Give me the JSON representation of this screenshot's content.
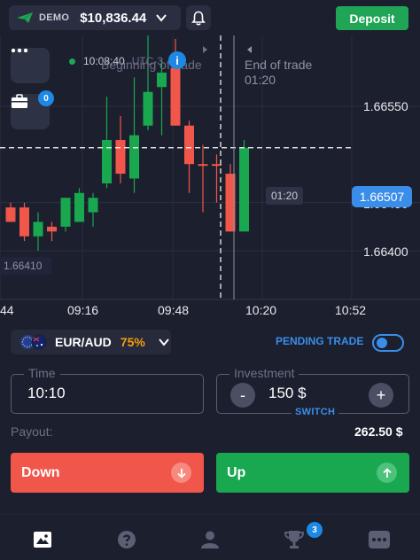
{
  "header": {
    "account_type": "DEMO",
    "balance": "$10,836.44",
    "deposit_label": "Deposit"
  },
  "chart": {
    "menu_badge": "0",
    "server_time": "10:08:40",
    "timezone": "UTC-3",
    "beginning_label": "Beginning of trade",
    "end_label": "End of trade",
    "end_time": "01:20",
    "current_price": "1.66507",
    "timer": "01:20",
    "low_price": "1.66410"
  },
  "chart_data": {
    "type": "candlestick",
    "y_ticks": [
      "1.66550",
      "1.66450",
      "1.66400"
    ],
    "x_ticks": [
      "44",
      "09:16",
      "09:48",
      "10:20",
      "10:52"
    ],
    "ylim": [
      1.6635,
      1.6672
    ],
    "current_price": 1.66507,
    "candles": [
      {
        "open": 1.66445,
        "close": 1.6643,
        "high": 1.6645,
        "low": 1.6643
      },
      {
        "open": 1.66445,
        "close": 1.66415,
        "high": 1.6645,
        "low": 1.6641
      },
      {
        "open": 1.66415,
        "close": 1.6643,
        "high": 1.6644,
        "low": 1.664
      },
      {
        "open": 1.66425,
        "close": 1.6642,
        "high": 1.6643,
        "low": 1.6641
      },
      {
        "open": 1.66425,
        "close": 1.66455,
        "high": 1.66455,
        "low": 1.6642
      },
      {
        "open": 1.6643,
        "close": 1.6646,
        "high": 1.66465,
        "low": 1.6643
      },
      {
        "open": 1.6644,
        "close": 1.66455,
        "high": 1.6646,
        "low": 1.66425
      },
      {
        "open": 1.6647,
        "close": 1.66515,
        "high": 1.6656,
        "low": 1.66465
      },
      {
        "open": 1.66515,
        "close": 1.6648,
        "high": 1.6654,
        "low": 1.6647
      },
      {
        "open": 1.66475,
        "close": 1.6652,
        "high": 1.6658,
        "low": 1.6646
      },
      {
        "open": 1.6653,
        "close": 1.66565,
        "high": 1.6663,
        "low": 1.66525
      },
      {
        "open": 1.6657,
        "close": 1.66585,
        "high": 1.666,
        "low": 1.6652
      },
      {
        "open": 1.6659,
        "close": 1.6653,
        "high": 1.6662,
        "low": 1.6653
      },
      {
        "open": 1.6653,
        "close": 1.6649,
        "high": 1.66535,
        "low": 1.6646
      },
      {
        "open": 1.6649,
        "close": 1.6649,
        "high": 1.6651,
        "low": 1.6644
      },
      {
        "open": 1.6649,
        "close": 1.6649,
        "high": 1.665,
        "low": 1.6645
      },
      {
        "open": 1.6648,
        "close": 1.6642,
        "high": 1.6649,
        "low": 1.6642
      },
      {
        "open": 1.6642,
        "close": 1.66507,
        "high": 1.66515,
        "low": 1.6642
      }
    ]
  },
  "asset": {
    "pair": "EUR/AUD",
    "payout_percent": "75%"
  },
  "pending_trade_label": "PENDING TRADE",
  "time_field": {
    "label": "Time",
    "value": "10:10"
  },
  "investment_field": {
    "label": "Investment",
    "value": "150 $",
    "switch_label": "SWITCH",
    "minus": "-",
    "plus": "+"
  },
  "payout": {
    "label": "Payout:",
    "value": "262.50 $"
  },
  "trade": {
    "down_label": "Down",
    "up_label": "Up"
  },
  "nav": {
    "tournaments_badge": "3"
  },
  "colors": {
    "background": "#1c1f2d",
    "up": "#19a84f",
    "down": "#f1564a",
    "accent": "#3a8eea",
    "payout_percent": "#f59e0b"
  }
}
